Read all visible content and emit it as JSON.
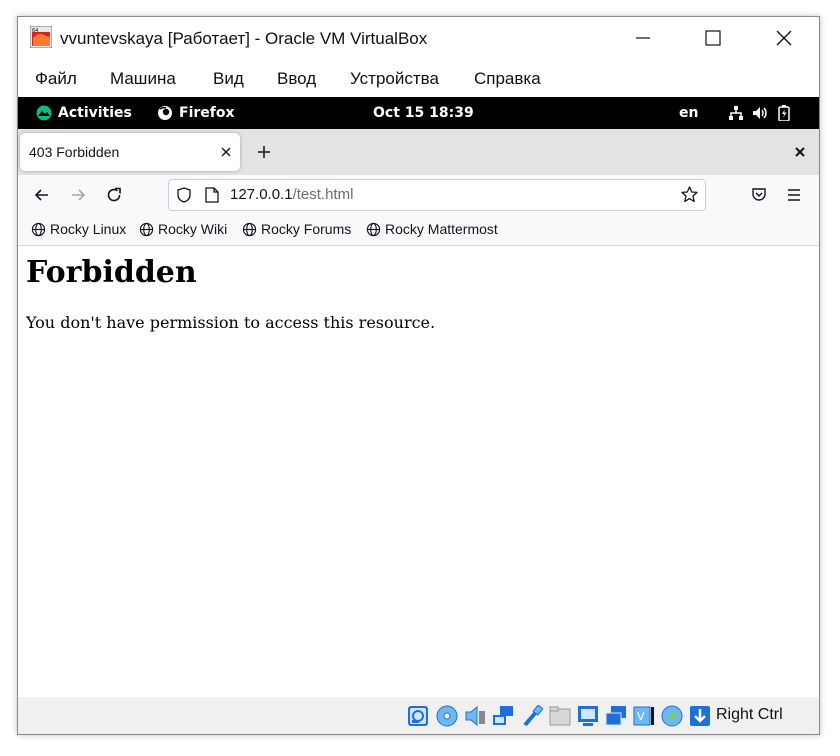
{
  "window": {
    "title": "vvuntevskaya [Работает] - Oracle VM VirtualBox"
  },
  "menu": [
    "Файл",
    "Машина",
    "Вид",
    "Ввод",
    "Устройства",
    "Справка"
  ],
  "gnome": {
    "activities": "Activities",
    "app": "Firefox",
    "clock": "Oct 15  18:39",
    "lang": "en"
  },
  "browser": {
    "tab_title": "403 Forbidden",
    "url_host": "127.0.0.1",
    "url_path": "/test.html",
    "bookmarks": [
      "Rocky Linux",
      "Rocky Wiki",
      "Rocky Forums",
      "Rocky Mattermost"
    ]
  },
  "page": {
    "heading": "Forbidden",
    "message": "You don't have permission to access this resource."
  },
  "statusbar": {
    "host_key": "Right Ctrl",
    "icons": [
      "hard-disk-icon",
      "optical-drive-icon",
      "audio-icon",
      "network-icon",
      "usb-icon",
      "shared-folders-icon",
      "display-icon",
      "video-capture-icon",
      "guest-additions-icon",
      "mouse-integration-icon",
      "keyboard-icon"
    ]
  },
  "colors": {
    "gnome_bar": "#000000",
    "tab_strip": "#e3e3e6",
    "toolbar": "#f9f9fb",
    "accent_blue": "#1e6fd9",
    "rocky_green": "#10b981"
  }
}
